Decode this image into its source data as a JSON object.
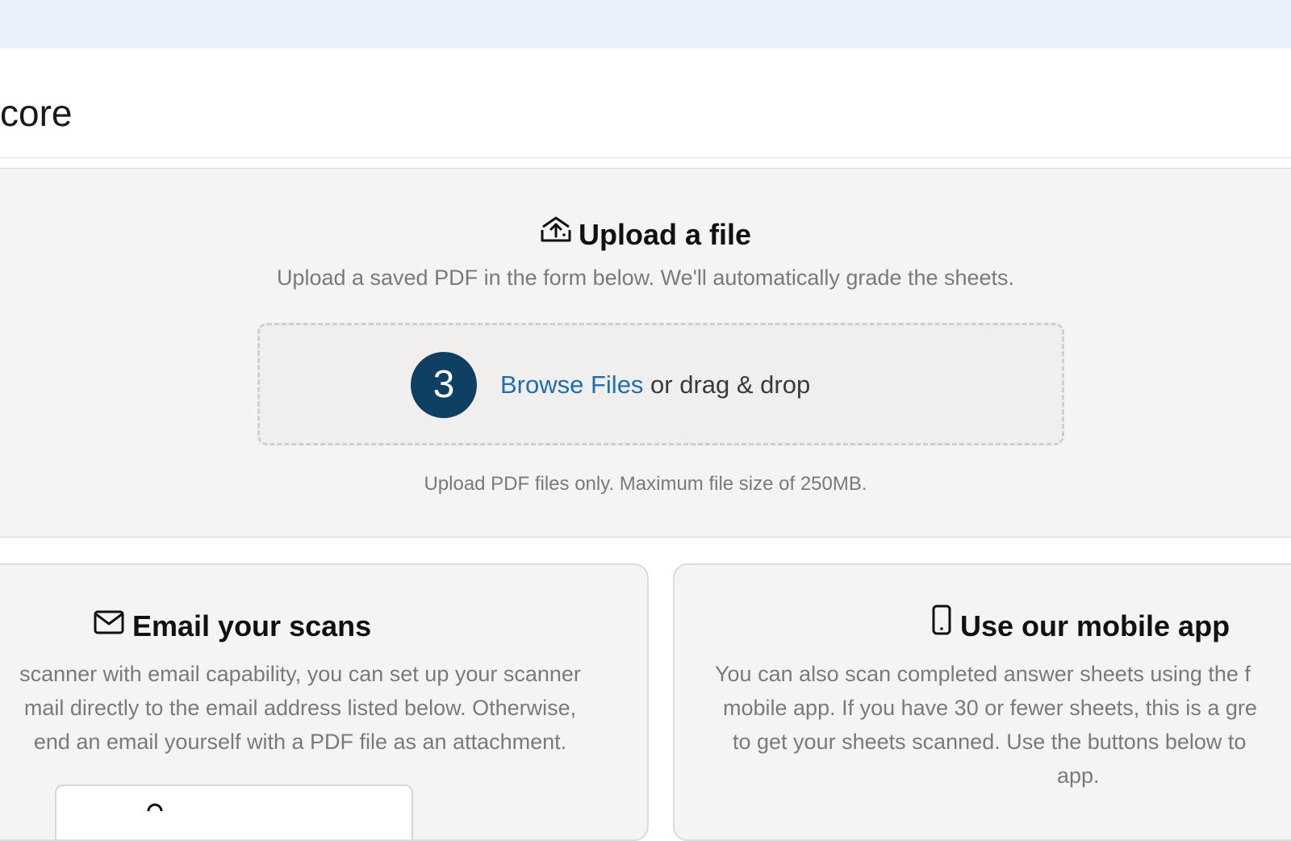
{
  "page": {
    "title": "core"
  },
  "upload": {
    "heading": "Upload a file",
    "icon": "upload-icon",
    "description": "Upload a saved PDF in the form below. We'll automatically grade the sheets.",
    "step_number": "3",
    "browse_label": "Browse Files",
    "drag_text": " or drag & drop",
    "note": "Upload PDF files only. Maximum file size of 250MB."
  },
  "email_card": {
    "heading": "Email your scans",
    "icon": "envelope-icon",
    "lines": [
      "scanner with email capability, you can set up your scanner",
      "mail directly to the email address listed below. Otherwise,",
      "end an email yourself with a PDF file as an attachment."
    ]
  },
  "mobile_card": {
    "heading": "Use our mobile app",
    "icon": "phone-icon",
    "lines": [
      "You can also scan completed answer sheets using the f",
      "mobile app. If you have 30 or fewer sheets, this is a gre",
      "to get your sheets scanned. Use the buttons below to",
      "app."
    ]
  },
  "colors": {
    "topbar": "#e8f0fa",
    "badge": "#0f4064",
    "link": "#1f6db5",
    "section_bg": "#f4f4f4"
  }
}
